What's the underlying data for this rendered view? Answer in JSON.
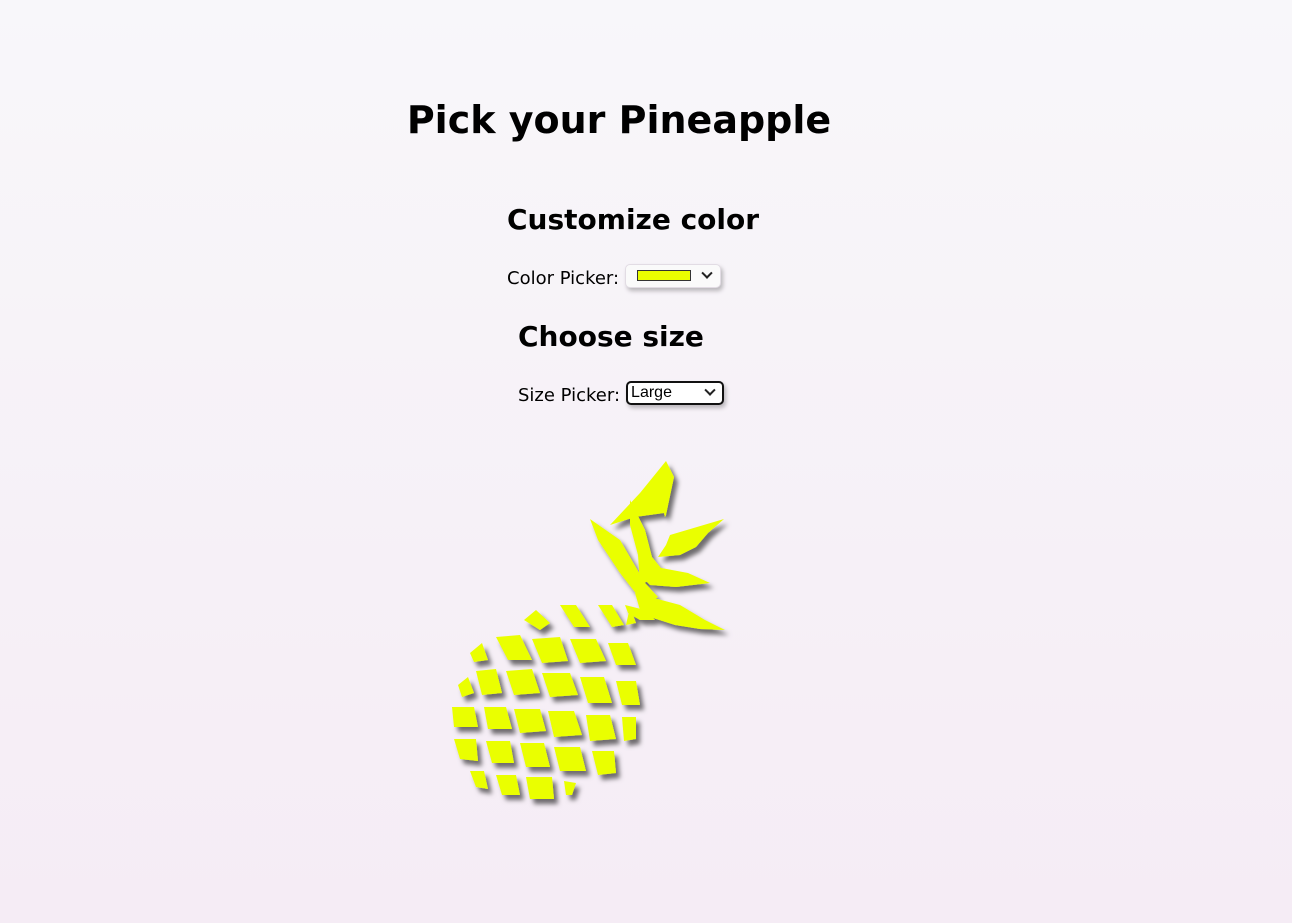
{
  "page": {
    "title": "Pick your Pineapple"
  },
  "color_section": {
    "title": "Customize color",
    "label": "Color Picker:",
    "value": "#eaff00"
  },
  "size_section": {
    "title": "Choose size",
    "label": "Size Picker:",
    "selected": "Large"
  },
  "pineapple": {
    "icon": "pineapple-icon",
    "color": "#eaff00"
  }
}
